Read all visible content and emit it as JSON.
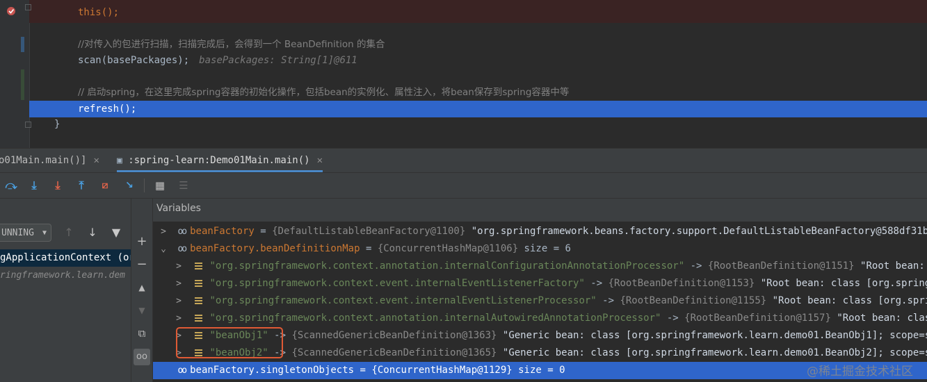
{
  "editor": {
    "lines": {
      "this_call": "this();",
      "comment_scan": "//对传入的包进行扫描，扫描完成后，会得到一个 BeanDefinition 的集合",
      "scan_call": "scan(basePackages);",
      "scan_hint": "basePackages: String[1]@611",
      "comment_refresh": "// 启动spring，在这里完成spring容器的初始化操作，包括bean的实例化、属性注入，将bean保存到spring容器中等",
      "refresh_call": "refresh();",
      "closing_brace": "}"
    }
  },
  "debug": {
    "tabs": [
      {
        "label": "o01Main.main()]"
      },
      {
        "label": ":spring-learn:Demo01Main.main()"
      }
    ],
    "toolbar_icons": [
      "step-over-icon",
      "step-into-icon",
      "force-step-into-icon",
      "step-out-icon",
      "drop-frame-icon",
      "run-to-cursor-icon",
      "evaluate-expression-icon",
      "trace-icon"
    ],
    "frames": {
      "thread_value": "UNNING",
      "items": [
        {
          "label": "gApplicationContext (or"
        },
        {
          "label": "ringframework.learn.dem"
        }
      ]
    },
    "variables": {
      "title": "Variables",
      "rows": [
        {
          "name": "beanFactory",
          "op": " = ",
          "type": "{DefaultListableBeanFactory@1100}",
          "value": " \"org.springframework.beans.factory.support.DefaultListableBeanFactory@588df31b"
        },
        {
          "name": "beanFactory.beanDefinitionMap",
          "op": " = ",
          "type": "{ConcurrentHashMap@1106}",
          "value": "  size = 6"
        },
        {
          "key": "\"org.springframework.context.annotation.internalConfigurationAnnotationProcessor\"",
          "op": " -> ",
          "type": "{RootBeanDefinition@1151}",
          "value": " \"Root bean: c"
        },
        {
          "key": "\"org.springframework.context.event.internalEventListenerFactory\"",
          "op": " -> ",
          "type": "{RootBeanDefinition@1153}",
          "value": " \"Root bean: class [org.springf"
        },
        {
          "key": "\"org.springframework.context.event.internalEventListenerProcessor\"",
          "op": " -> ",
          "type": "{RootBeanDefinition@1155}",
          "value": " \"Root bean: class [org.sprin"
        },
        {
          "key": "\"org.springframework.context.annotation.internalAutowiredAnnotationProcessor\"",
          "op": " -> ",
          "type": "{RootBeanDefinition@1157}",
          "value": " \"Root bean: class"
        },
        {
          "key": "\"beanObj1\"",
          "op": " -> ",
          "type": "{ScannedGenericBeanDefinition@1363}",
          "value": " \"Generic bean: class [org.springframework.learn.demo01.BeanObj1]; scope=si"
        },
        {
          "key": "\"beanObj2\"",
          "op": " -> ",
          "type": "{ScannedGenericBeanDefinition@1365}",
          "value": " \"Generic bean: class [org.springframework.learn.demo01.BeanObj2]; scope=si"
        },
        {
          "name": "beanFactory.singletonObjects",
          "op": " = ",
          "type": "{ConcurrentHashMap@1129}",
          "value": "  size = 0"
        }
      ]
    }
  },
  "watermark": "@稀土掘金技术社区",
  "colors": {
    "editor_bg": "#2b2b2b",
    "panel_bg": "#3c3f41",
    "selection": "#2f65ca",
    "keyword": "#cc7832",
    "string": "#6a8759",
    "highlight_box": "#e05a35"
  }
}
